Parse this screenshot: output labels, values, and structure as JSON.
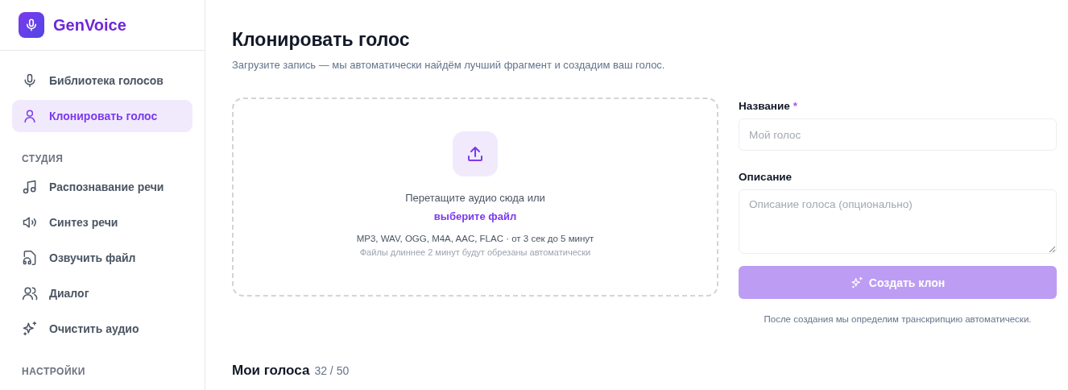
{
  "sidebar": {
    "brand": "GenVoice",
    "items": [
      {
        "label": "Библиотека голосов",
        "selected": false
      },
      {
        "label": "Клонировать голос",
        "selected": true
      }
    ],
    "sections": [
      {
        "title": "СТУДИЯ",
        "items": [
          {
            "label": "Распознавание речи",
            "selected": false
          },
          {
            "label": "Синтез речи",
            "selected": false
          },
          {
            "label": "Озвучить файл",
            "selected": false
          },
          {
            "label": "Диалог",
            "selected": false
          },
          {
            "label": "Очистить аудио",
            "selected": false
          }
        ]
      },
      {
        "title": "НАСТРОЙКИ"
      }
    ]
  },
  "page": {
    "title": "Клонировать голос",
    "subtitle": "Загрузите запись — мы автоматически найдём лучший фрагмент и создадим ваш голос."
  },
  "dropzone": {
    "prompt": "Перетащите аудио сюда или",
    "link": "выберите файл",
    "formats": "MP3, WAV, OGG, M4A, AAC, FLAC · от 3 сек до 5 минут",
    "note": "Файлы длиннее 2 минут будут обрезаны автоматически"
  },
  "form": {
    "name_label": "Название",
    "required_mark": "*",
    "name_placeholder": "Мой голос",
    "description_label": "Описание",
    "description_placeholder": "Описание голоса (опционально)",
    "button": {
      "label": "Создать клон",
      "disabled": true
    },
    "hint": "После создания мы определим транскрипцию автоматически."
  },
  "voices": {
    "title": "Мои голоса",
    "count": "32 / 50"
  }
}
